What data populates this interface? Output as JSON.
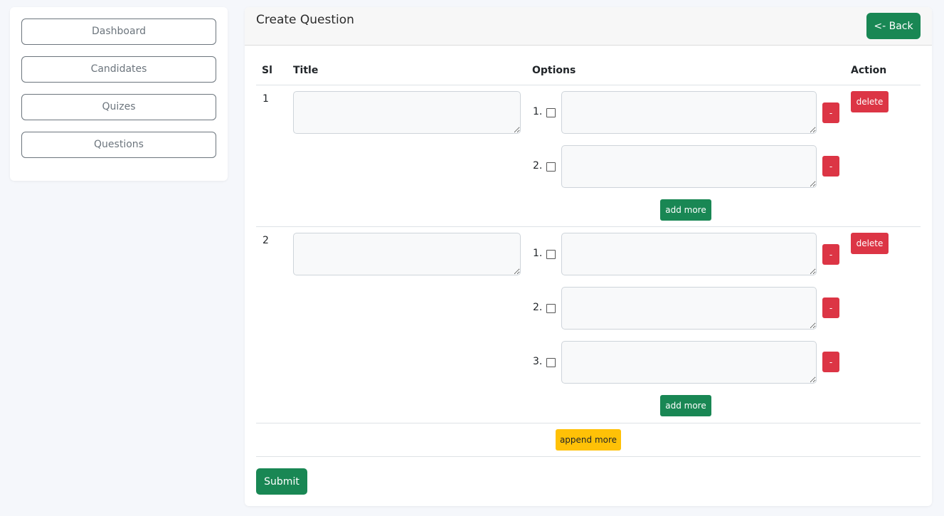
{
  "sidebar": {
    "items": [
      {
        "label": "Dashboard"
      },
      {
        "label": "Candidates"
      },
      {
        "label": "Quizes"
      },
      {
        "label": "Questions"
      }
    ]
  },
  "header": {
    "title": "Create Question",
    "back_label": "<- Back"
  },
  "table": {
    "columns": [
      "Sl",
      "Title",
      "Options",
      "Action"
    ],
    "questions": [
      {
        "si": "1",
        "title_value": "",
        "options": [
          {
            "number": "1.",
            "value": "",
            "remove_label": "-"
          },
          {
            "number": "2.",
            "value": "",
            "remove_label": "-"
          }
        ],
        "add_more_label": "add more",
        "delete_label": "delete"
      },
      {
        "si": "2",
        "title_value": "",
        "options": [
          {
            "number": "1.",
            "value": "",
            "remove_label": "-"
          },
          {
            "number": "2.",
            "value": "",
            "remove_label": "-"
          },
          {
            "number": "3.",
            "value": "",
            "remove_label": "-"
          }
        ],
        "add_more_label": "add more",
        "delete_label": "delete"
      }
    ]
  },
  "append_more_label": "append more",
  "submit_label": "Submit",
  "colors": {
    "primary_green": "#198754",
    "danger_red": "#dc3545",
    "warning_yellow": "#ffc107",
    "page_background": "#f5f7fb"
  }
}
